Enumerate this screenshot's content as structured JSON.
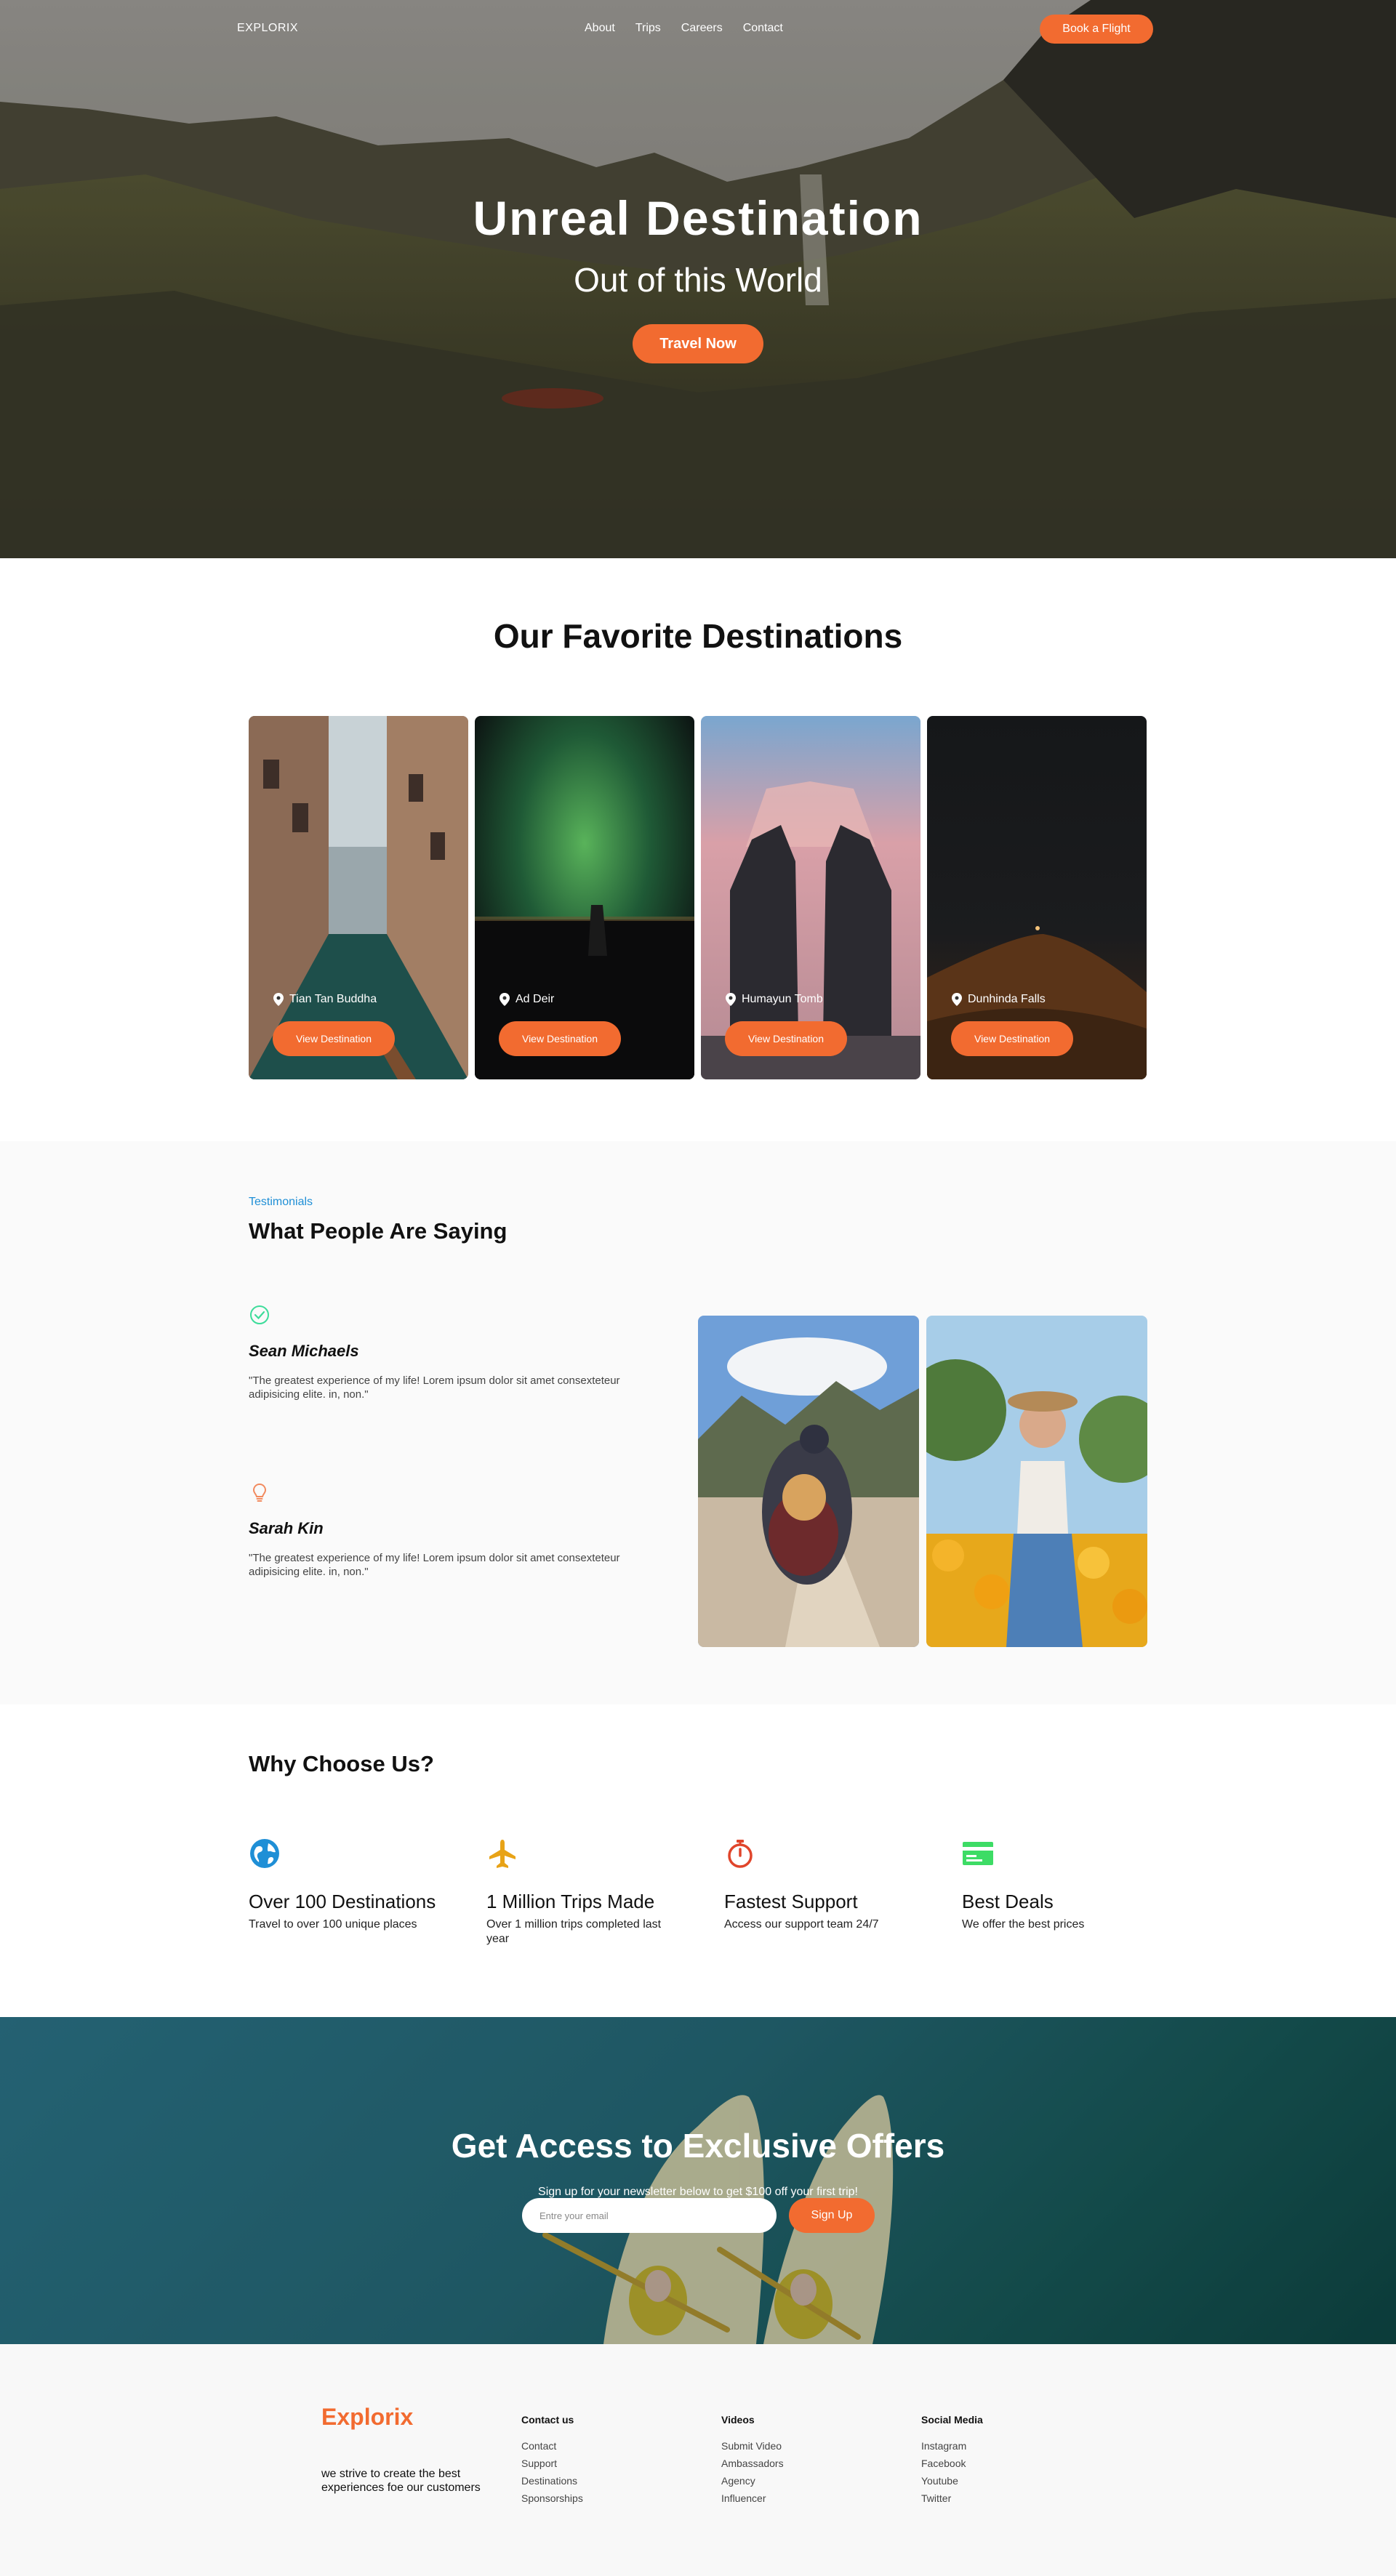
{
  "nav": {
    "logo": "EXPLORIX",
    "links": [
      "About",
      "Trips",
      "Careers",
      "Contact"
    ],
    "cta": "Book a Flight"
  },
  "hero": {
    "title": "Unreal Destination",
    "subtitle": "Out of this World",
    "cta": "Travel Now"
  },
  "destinations": {
    "title": "Our Favorite Destinations",
    "button_label": "View Destination",
    "items": [
      {
        "name": "Tian Tan Buddha"
      },
      {
        "name": "Ad Deir"
      },
      {
        "name": "Humayun Tomb"
      },
      {
        "name": "Dunhinda Falls"
      }
    ]
  },
  "testimonials": {
    "eyebrow": "Testimonials",
    "heading": "What People Are Saying",
    "items": [
      {
        "name": "Sean Michaels",
        "quote": "\"The greatest experience of my life! Lorem ipsum dolor sit amet consexteteur adipisicing elite. in, non.\"",
        "icon": "check-circle-icon"
      },
      {
        "name": "Sarah Kin",
        "quote": "\"The greatest experience of my life! Lorem ipsum dolor sit amet consexteteur adipisicing elite. in, non.\"",
        "icon": "lightbulb-icon"
      }
    ]
  },
  "why": {
    "heading": "Why Choose Us?",
    "features": [
      {
        "title": "Over 100 Destinations",
        "desc": "Travel to over 100 unique places",
        "icon": "globe-icon",
        "color": "#1f8fd6"
      },
      {
        "title": "1 Million Trips Made",
        "desc": "Over 1 million trips completed last year",
        "icon": "plane-icon",
        "color": "#e8a317"
      },
      {
        "title": "Fastest Support",
        "desc": "Access our support team 24/7",
        "icon": "stopwatch-icon",
        "color": "#e0452b"
      },
      {
        "title": "Best Deals",
        "desc": "We offer the best prices",
        "icon": "money-bill-icon",
        "color": "#3ddc65"
      }
    ]
  },
  "newsletter": {
    "title": "Get Access to Exclusive Offers",
    "subtitle": "Sign up for your newsletter below to get $100 off your first trip!",
    "placeholder": "Entre your email",
    "cta": "Sign Up"
  },
  "footer": {
    "logo": "Explorix",
    "tagline": "we strive to create the best experiences foe our customers",
    "columns": [
      {
        "heading": "Contact us",
        "links": [
          "Contact",
          "Support",
          "Destinations",
          "Sponsorships"
        ]
      },
      {
        "heading": "Videos",
        "links": [
          "Submit Video",
          "Ambassadors",
          "Agency",
          "Influencer"
        ]
      },
      {
        "heading": "Social Media",
        "links": [
          "Instagram",
          "Facebook",
          "Youtube",
          "Twitter"
        ]
      }
    ]
  },
  "colors": {
    "accent": "#f26b30",
    "link_blue": "#1f8fd6"
  }
}
